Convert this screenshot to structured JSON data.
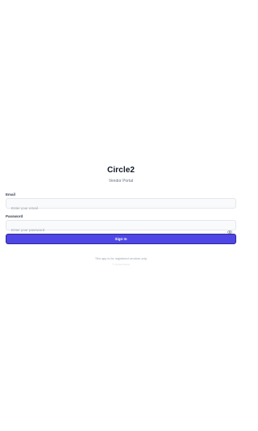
{
  "brand": {
    "title": "Circle2",
    "subtitle": "Vendor Portal"
  },
  "form": {
    "email": {
      "label": "Email",
      "placeholder": "Enter your email",
      "value": ""
    },
    "password": {
      "label": "Password",
      "placeholder": "Enter your password",
      "value": "",
      "toggle_icon": "eye-icon"
    },
    "submit_label": "Sign In"
  },
  "footer": {
    "note": "This app is for registered vendors only",
    "meta": "© Circle2 Portal"
  },
  "colors": {
    "accent": "#4f46e5",
    "background": "#ffffff",
    "input_bg": "#f9fafb",
    "title": "#111827",
    "muted": "#9ca3af"
  }
}
